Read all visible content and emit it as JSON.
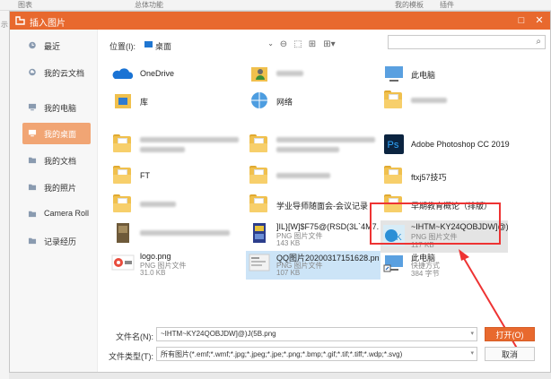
{
  "background_app": {
    "toolbar_labels": [
      "图表",
      "总体功能",
      "我的模板",
      "插件"
    ],
    "left_char": "示"
  },
  "dialog": {
    "title": "插入图片",
    "accent": "#e8692e"
  },
  "sidebar": {
    "items": [
      {
        "label": "最近",
        "icon": "clock-icon"
      },
      {
        "label": "我的云文档",
        "icon": "cloud-icon"
      },
      {
        "label": "我的电脑",
        "icon": "computer-icon"
      },
      {
        "label": "我的桌面",
        "icon": "desktop-icon",
        "active": true
      },
      {
        "label": "我的文档",
        "icon": "folder-icon"
      },
      {
        "label": "我的照片",
        "icon": "folder-icon"
      },
      {
        "label": "Camera Roll",
        "icon": "folder-icon"
      },
      {
        "label": "记录经历",
        "icon": "folder-icon"
      }
    ]
  },
  "location": {
    "label": "位置(I):",
    "value": "桌面"
  },
  "files": {
    "onedrive": "OneDrive",
    "library": "库",
    "network": "网络",
    "this_pc": "此电脑",
    "ft": "FT",
    "ps": "Adobe Photoshop CC 2019",
    "ftxj": "ftxj57技巧",
    "xuexi": "学业导师随面会-会议记录",
    "zaoqi": "早期教育概论（排版）",
    "jil_name": "]IL}[W]$F75@(RSD(3L`4M7.p...",
    "jil_type": "PNG 图片文件",
    "jil_size": "143 KB",
    "ihtm_name": "~IHTM~KY24QOBJDW]@)(...",
    "ihtm_type": "PNG 图片文件",
    "ihtm_size": "117 KB",
    "logo_name": "logo.png",
    "logo_type": "PNG 图片文件",
    "logo_size": "31.0 KB",
    "qq_name": "QQ图片20200317151628.png",
    "qq_type": "PNG 图片文件",
    "qq_size": "107 KB",
    "pc_name": "此电脑",
    "pc_type": "快捷方式",
    "pc_size": "384 字节"
  },
  "filename": {
    "label": "文件名(N):",
    "value": "~IHTM~KY24QOBJDW]@)J(5B.png"
  },
  "filetype": {
    "label": "文件类型(T):",
    "value": "所有图片(*.emf;*.wmf;*.jpg;*.jpeg;*.jpe;*.png;*.bmp;*.gif;*.tif;*.tiff;*.wdp;*.svg)"
  },
  "buttons": {
    "open": "打开(O)",
    "cancel": "取消"
  }
}
